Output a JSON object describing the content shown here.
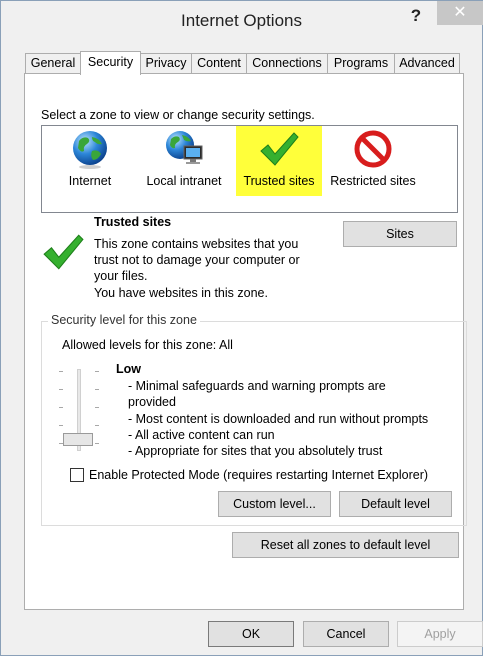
{
  "window": {
    "title": "Internet Options",
    "help_label": "?",
    "close_label": "✕"
  },
  "tabs": [
    {
      "label": "General"
    },
    {
      "label": "Security"
    },
    {
      "label": "Privacy"
    },
    {
      "label": "Content"
    },
    {
      "label": "Connections"
    },
    {
      "label": "Programs"
    },
    {
      "label": "Advanced"
    }
  ],
  "active_tab": "Security",
  "zones": {
    "instruction": "Select a zone to view or change security settings.",
    "items": [
      {
        "label": "Internet",
        "icon": "globe-icon"
      },
      {
        "label": "Local intranet",
        "icon": "network-globe-icon"
      },
      {
        "label": "Trusted sites",
        "icon": "green-check-icon"
      },
      {
        "label": "Restricted sites",
        "icon": "red-prohibited-icon"
      }
    ],
    "selected": "Trusted sites",
    "highlight_color": "#ffff3a"
  },
  "zone_info": {
    "title": "Trusted sites",
    "description_lines": [
      "This zone contains websites that you",
      "trust not to damage your computer or",
      "your files."
    ],
    "note": "You have websites in this zone.",
    "sites_button": "Sites"
  },
  "security_level": {
    "group_title": "Security level for this zone",
    "allowed_levels": "Allowed levels for this zone: All",
    "level_name": "Low",
    "bullets": [
      "- Minimal safeguards and warning prompts are",
      "provided",
      "- Most content is downloaded and run without prompts",
      "- All active content can run",
      "- Appropriate for sites that you absolutely trust"
    ],
    "protected_mode_label": "Enable Protected Mode (requires restarting Internet Explorer)",
    "protected_mode_checked": false,
    "custom_level_button": "Custom level...",
    "default_level_button": "Default level"
  },
  "reset_all_button": "Reset all zones to default level",
  "footer": {
    "ok": "OK",
    "cancel": "Cancel",
    "apply": "Apply"
  }
}
